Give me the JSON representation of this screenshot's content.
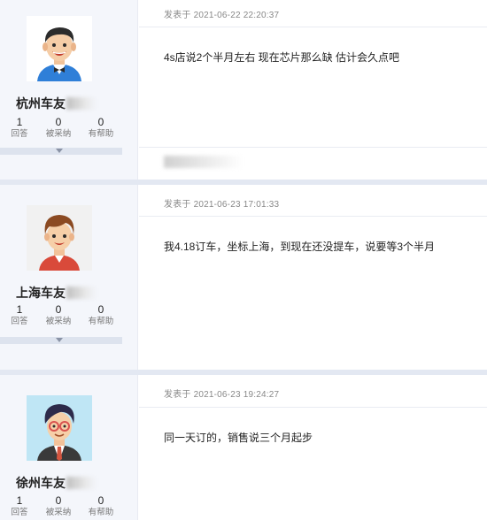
{
  "posts": [
    {
      "user": {
        "name": "杭州车友",
        "avatar": "man-bowtie-avatar"
      },
      "stats": [
        {
          "num": "1",
          "label": "回答"
        },
        {
          "num": "0",
          "label": "被采纳"
        },
        {
          "num": "0",
          "label": "有帮助"
        }
      ],
      "meta": "发表于 2021-06-22 22:20:37",
      "content": "4s店说2个半月左右 现在芯片那么缺 估计会久点吧"
    },
    {
      "user": {
        "name": "上海车友",
        "avatar": "boy-red-shirt-avatar"
      },
      "stats": [
        {
          "num": "1",
          "label": "回答"
        },
        {
          "num": "0",
          "label": "被采纳"
        },
        {
          "num": "0",
          "label": "有帮助"
        }
      ],
      "meta": "发表于 2021-06-23 17:01:33",
      "content": "我4.18订车，坐标上海，到现在还没提车，说要等3个半月"
    },
    {
      "user": {
        "name": "徐州车友",
        "avatar": "glasses-tie-avatar"
      },
      "stats": [
        {
          "num": "1",
          "label": "回答"
        },
        {
          "num": "0",
          "label": "被采纳"
        },
        {
          "num": "0",
          "label": "有帮助"
        }
      ],
      "meta": "发表于 2021-06-23 19:24:27",
      "content": "同一天订的，销售说三个月起步"
    }
  ],
  "colors": {
    "sidebar_bg": "#f4f6fb",
    "separator": "#e3e8f2",
    "text_meta": "#888888"
  }
}
